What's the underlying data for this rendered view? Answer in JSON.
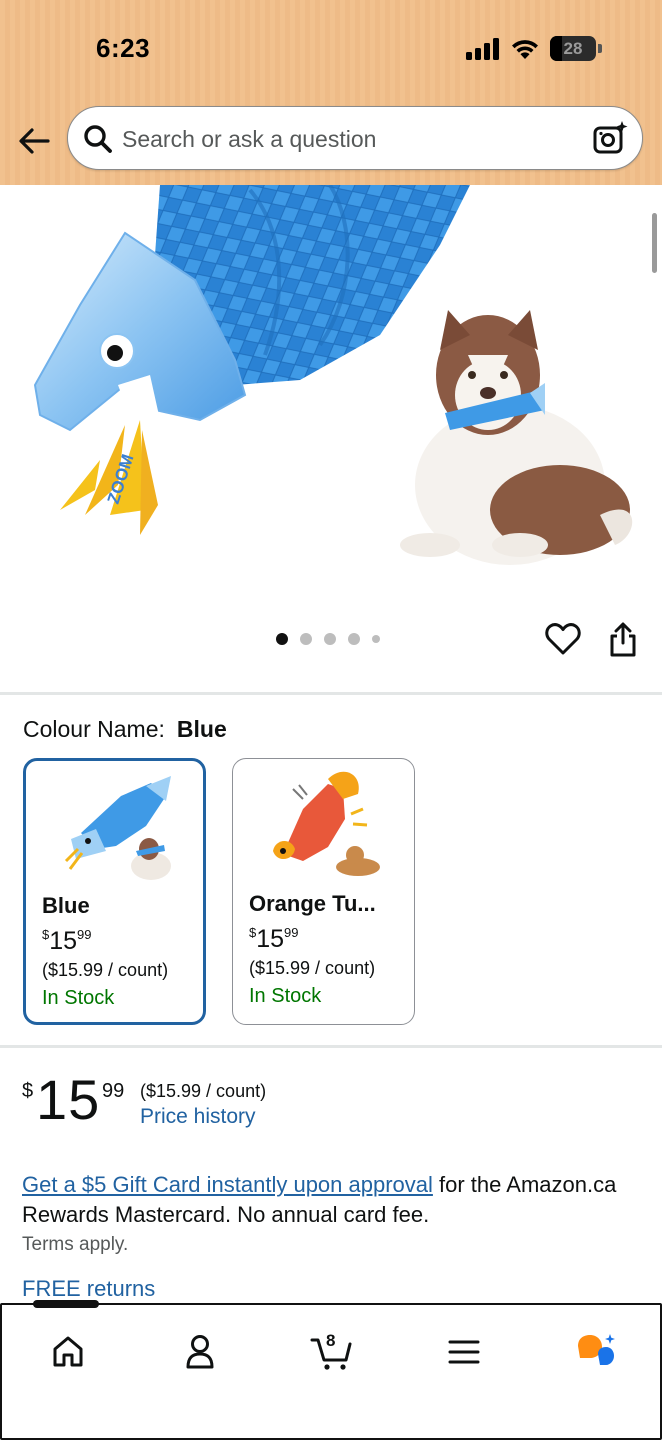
{
  "status_bar": {
    "time": "6:23",
    "battery": "28"
  },
  "header": {
    "search_placeholder": "Search or ask a question"
  },
  "gallery": {
    "image_count": 5,
    "active_index": 0,
    "image_text": "ZOOM"
  },
  "colour": {
    "label": "Colour Name:",
    "selected": "Blue",
    "options": [
      {
        "name": "Blue",
        "price_whole": "15",
        "price_fraction": "99",
        "currency": "$",
        "unit_price": "($15.99 / count)",
        "stock": "In Stock",
        "selected": true
      },
      {
        "name": "Orange Tu...",
        "price_whole": "15",
        "price_fraction": "99",
        "currency": "$",
        "unit_price": "($15.99 / count)",
        "stock": "In Stock",
        "selected": false
      }
    ]
  },
  "price": {
    "currency": "$",
    "whole": "15",
    "fraction": "99",
    "unit_price": "($15.99 / count)",
    "history_link": "Price history"
  },
  "promo": {
    "link_text": "Get a $5 Gift Card instantly upon approval",
    "rest_text": " for the Amazon.ca Rewards Mastercard. No annual card fee.",
    "terms": "Terms apply."
  },
  "returns": {
    "label": "FREE returns"
  },
  "bottom_nav": {
    "cart_count": "8"
  },
  "colors": {
    "accent_link": "#2162a1",
    "stock_green": "#007600",
    "header_bg": "#f1c18e",
    "selected_border": "#2162a1"
  }
}
